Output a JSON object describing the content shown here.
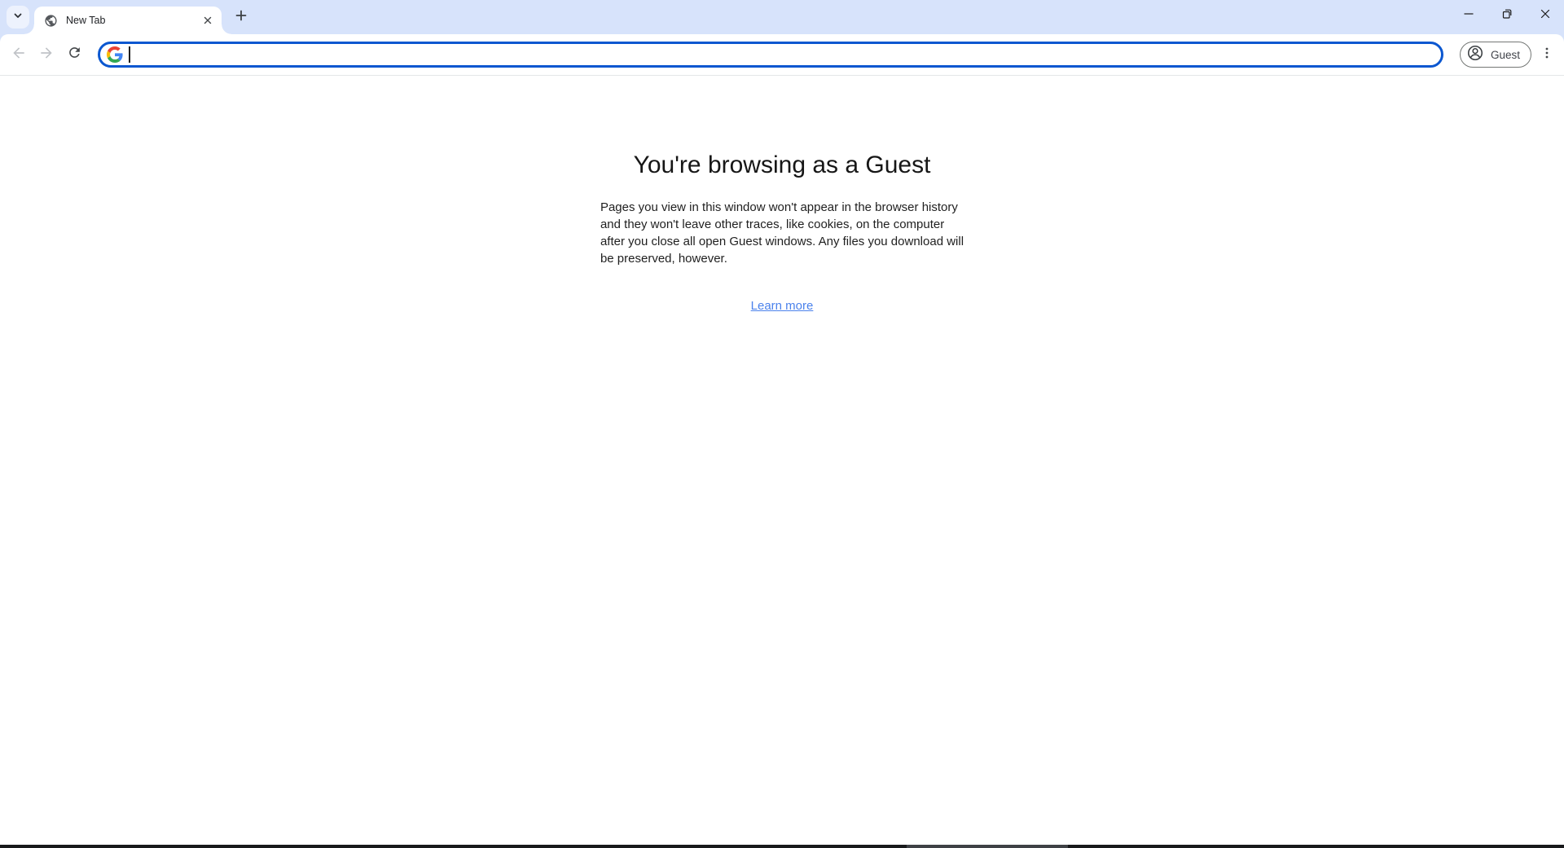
{
  "colors": {
    "accent": "#0b57d0",
    "tabstrip_bg": "#d7e3fb",
    "link": "#4b82ec",
    "divider": "#e4e6e8"
  },
  "tabstrip": {
    "tab": {
      "title": "New Tab",
      "favicon": "globe-icon"
    },
    "tab_search_icon": "chevron-down-icon",
    "new_tab_icon": "plus-icon"
  },
  "window_controls": {
    "minimize_icon": "minimize-icon",
    "restore_icon": "restore-icon",
    "close_icon": "close-icon"
  },
  "toolbar": {
    "back_icon": "arrow-back-icon",
    "forward_icon": "arrow-forward-icon",
    "reload_icon": "reload-icon",
    "omnibox": {
      "value": "",
      "placeholder": "",
      "search_icon": "google-g-icon"
    },
    "guest_chip": {
      "label": "Guest",
      "icon": "person-circle-icon"
    },
    "menu_icon": "three-dot-menu-icon"
  },
  "content": {
    "heading": "You're browsing as a Guest",
    "body": "Pages you view in this window won't appear in the browser history\nand they won't leave other traces, like cookies, on the computer\nafter you close all open Guest windows. Any files you download will\nbe preserved, however.",
    "learn_more": "Learn more"
  }
}
